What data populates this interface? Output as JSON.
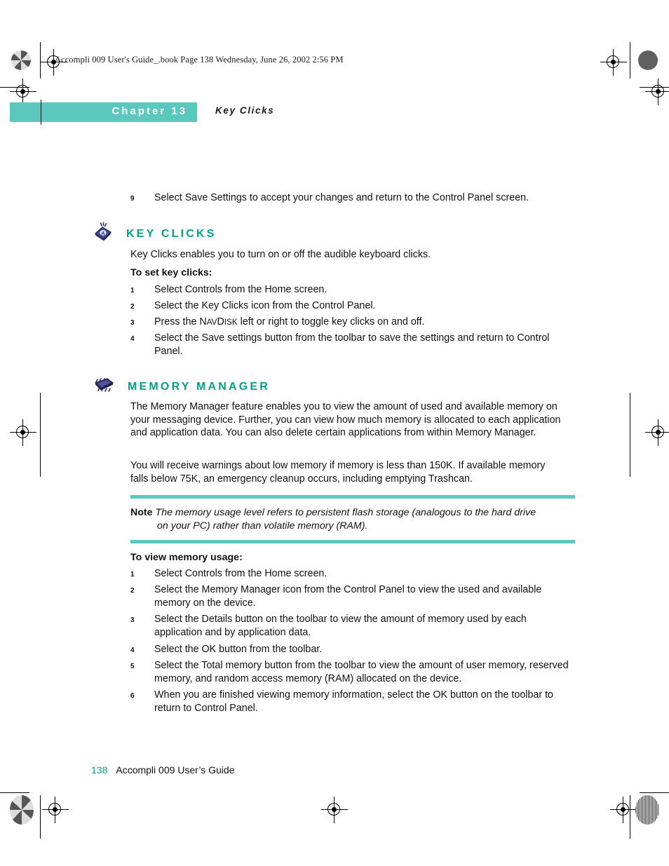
{
  "colors": {
    "teal_bar": "#5BC8BE",
    "teal_heading": "#00A189",
    "body_text": "#111111"
  },
  "file_info": "Accompli 009 User's Guide_.book  Page 138  Wednesday, June 26, 2002  2:56 PM",
  "chapter": {
    "label": "Chapter 13",
    "topic": "Key Clicks"
  },
  "intro_step": {
    "number": "9",
    "text": "Select Save Settings to accept your changes and return to the Control Panel screen."
  },
  "sections": [
    {
      "icon": "key-cap-icon",
      "title": "KEY CLICKS",
      "intro": "Key Clicks enables you to turn on or off the audible keyboard clicks.",
      "subhead": "To set key clicks:",
      "steps": [
        {
          "number": "1",
          "text": "Select Controls from the Home screen."
        },
        {
          "number": "2",
          "text": "Select the Key Clicks icon from the Control Panel."
        },
        {
          "number": "3",
          "text": "Press the NAVDISK left or right to toggle key clicks on and off."
        },
        {
          "number": "4",
          "text": "Select the Save settings button from the toolbar to save the settings and return to Control Panel."
        }
      ]
    },
    {
      "icon": "memory-chip-icon",
      "title": "MEMORY MANAGER",
      "paragraphs": [
        "The Memory Manager feature enables you to view the amount of used and available memory on your messaging device. Further, you can view how much memory is allocated to each application and application data. You can also delete certain applications from within Memory Manager.",
        "You will receive warnings about low memory if memory is less than 150K. If available memory falls below 75K, an emergency cleanup occurs, including emptying Trashcan."
      ],
      "note": {
        "label": "Note",
        "line1": "The memory usage level refers to persistent flash storage (analogous to the hard drive",
        "line2": "on your PC) rather than volatile memory (RAM)."
      },
      "subhead": "To view memory usage:",
      "steps": [
        {
          "number": "1",
          "text": "Select Controls from the Home screen."
        },
        {
          "number": "2",
          "text": "Select the Memory Manager icon from the Control Panel to view the used and available memory on the device."
        },
        {
          "number": "3",
          "text": "Select the Details button on the toolbar to view the amount of memory used by each application and by application data."
        },
        {
          "number": "4",
          "text": "Select the OK button from the toolbar."
        },
        {
          "number": "5",
          "text": "Select the Total memory button from the toolbar to view the amount of user memory, reserved memory, and random access memory (RAM) allocated on the device."
        },
        {
          "number": "6",
          "text": "When you are finished viewing memory information, select the OK button on the toolbar to return to Control Panel."
        }
      ]
    }
  ],
  "footer": {
    "page_number": "138",
    "guide_title": "Accompli 009 User’s Guide"
  }
}
